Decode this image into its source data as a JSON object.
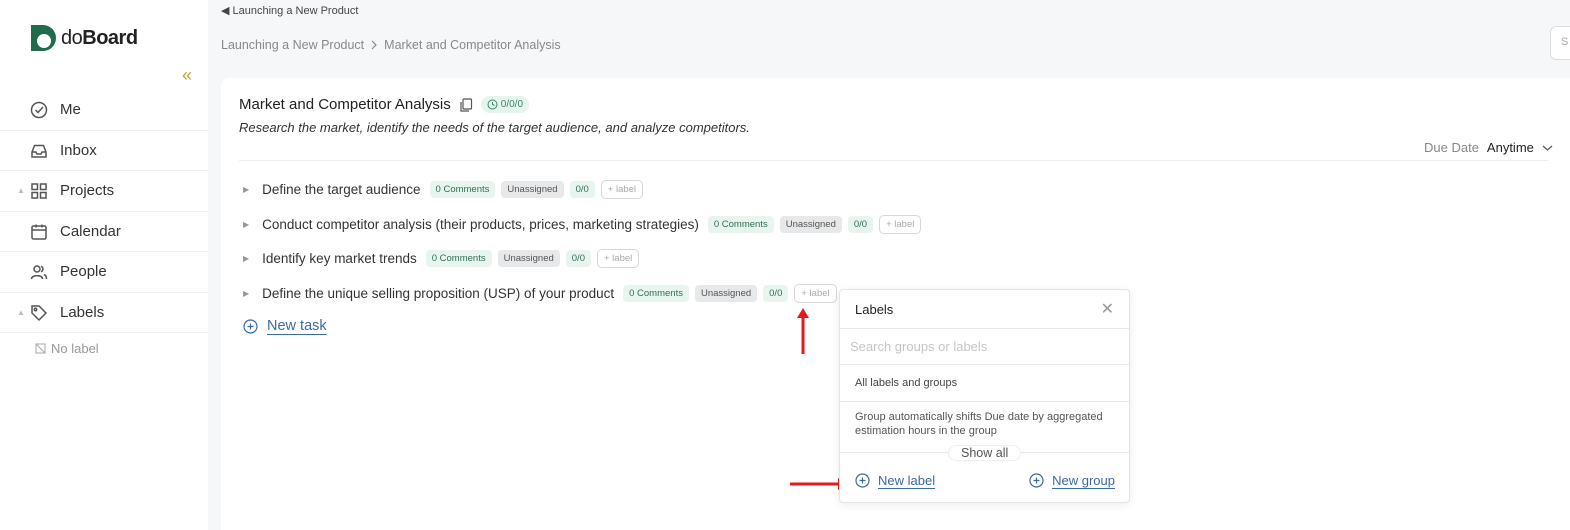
{
  "app": {
    "logo_text_light": "do",
    "logo_text_bold": "Board"
  },
  "sidebar": {
    "items": [
      {
        "label": "Me",
        "icon": "check-circle-icon"
      },
      {
        "label": "Inbox",
        "icon": "inbox-icon"
      },
      {
        "label": "Projects",
        "icon": "grid-icon"
      },
      {
        "label": "Calendar",
        "icon": "calendar-icon"
      },
      {
        "label": "People",
        "icon": "people-icon"
      },
      {
        "label": "Labels",
        "icon": "tag-icon"
      }
    ],
    "no_label": "No label"
  },
  "header": {
    "back_link": "Launching a New Product",
    "breadcrumb": [
      "Launching a New Product",
      "Market and Competitor Analysis"
    ]
  },
  "board": {
    "title": "Market and Competitor Analysis",
    "time_badge": "0/0/0",
    "description": "Research the market, identify the needs of the target audience, and analyze competitors.",
    "due_label": "Due Date",
    "due_value": "Anytime",
    "tasks": [
      {
        "name": "Define the target audience",
        "comments": "0 Comments",
        "assignee": "Unassigned",
        "progress": "0/0",
        "label_btn": "+ label"
      },
      {
        "name": "Conduct competitor analysis (their products, prices, marketing strategies)",
        "comments": "0 Comments",
        "assignee": "Unassigned",
        "progress": "0/0",
        "label_btn": "+ label"
      },
      {
        "name": "Identify key market trends",
        "comments": "0 Comments",
        "assignee": "Unassigned",
        "progress": "0/0",
        "label_btn": "+ label"
      },
      {
        "name": "Define the unique selling proposition (USP) of your product",
        "comments": "0 Comments",
        "assignee": "Unassigned",
        "progress": "0/0",
        "label_btn": "+ label"
      }
    ],
    "new_task": "New task"
  },
  "labels_popup": {
    "title": "Labels",
    "search_placeholder": "Search groups or labels",
    "all_labels": "All labels and groups",
    "group_note": "Group automatically shifts Due date by aggregated estimation hours in the group",
    "show_all": "Show all",
    "new_label": "New label",
    "new_group": "New group"
  },
  "colors": {
    "accent_link": "#3b6aa0",
    "annotation_arrow": "#e31b1b",
    "collapse_chevron": "#c9a227"
  }
}
